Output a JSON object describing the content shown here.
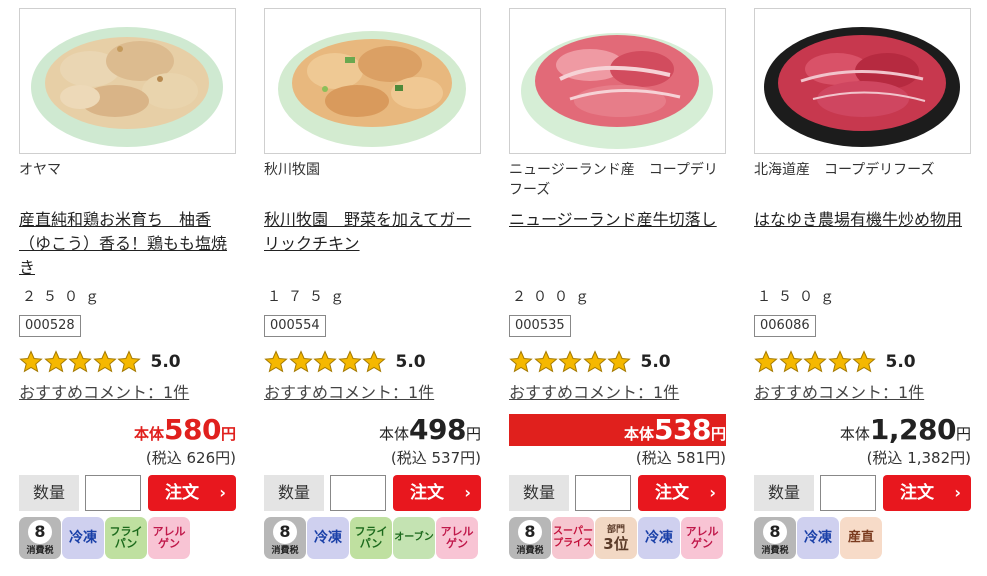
{
  "products": [
    {
      "maker": "オヤマ",
      "name": "産直純和鶏お米育ち　柚香（ゆこう）香る！鶏もも塩焼き",
      "weight": "２５０ｇ",
      "code": "000528",
      "rating": 5,
      "rating_text": "5.0",
      "comment": "おすすめコメント：1件",
      "price": {
        "style": "red",
        "label": "本体",
        "amount": "580",
        "unit": "円",
        "tax_in": "(税込 626円)"
      },
      "badges": [
        "8",
        "冷凍",
        "フライパン",
        "アレルゲン"
      ]
    },
    {
      "maker": "秋川牧園",
      "name": "秋川牧園　野菜を加えてガーリックチキン",
      "weight": "１７５ｇ",
      "code": "000554",
      "rating": 5,
      "rating_text": "5.0",
      "comment": "おすすめコメント：1件",
      "price": {
        "style": "black",
        "label": "本体",
        "amount": "498",
        "unit": "円",
        "tax_in": "(税込 537円)"
      },
      "badges": [
        "8",
        "冷凍",
        "フライパン",
        "オーブン",
        "アレルゲン"
      ]
    },
    {
      "maker": "ニュージーランド産　コープデリフーズ",
      "name": "ニュージーランド産牛切落し",
      "weight": "２００ｇ",
      "code": "000535",
      "rating": 5,
      "rating_text": "5.0",
      "comment": "おすすめコメント：1件",
      "price": {
        "style": "highlight",
        "label": "本体",
        "amount": "538",
        "unit": "円",
        "tax_in": "(税込 581円)"
      },
      "badges": [
        "8",
        "スーパープライス",
        "部門3位",
        "冷凍",
        "アレルゲン"
      ]
    },
    {
      "maker": "北海道産　コープデリフーズ",
      "name": "はなゆき農場有機牛炒め物用",
      "weight": "１５０ｇ",
      "code": "006086",
      "rating": 5,
      "rating_text": "5.0",
      "comment": "おすすめコメント：1件",
      "price": {
        "style": "black",
        "label": "本体",
        "amount": "1,280",
        "unit": "円",
        "tax_in": "(税込 1,382円)"
      },
      "badges": [
        "8",
        "冷凍",
        "産直"
      ]
    }
  ],
  "order": {
    "qty_label": "数量",
    "qty_value": "",
    "button_label": "注文",
    "button_chevron": "›"
  },
  "badge_text": {
    "tax_sub": "消費税",
    "frozen": "冷凍",
    "fry": "フライ\nパン",
    "oven": "オーブン",
    "allergen": "アレル\nゲン",
    "super": "スーパー\nプライス",
    "rank_top": "部門",
    "rank_big": "3位",
    "direct": "産直"
  },
  "colors": {
    "accent_red": "#e8171e",
    "price_red": "#e0201d",
    "star": "#f5b800"
  }
}
